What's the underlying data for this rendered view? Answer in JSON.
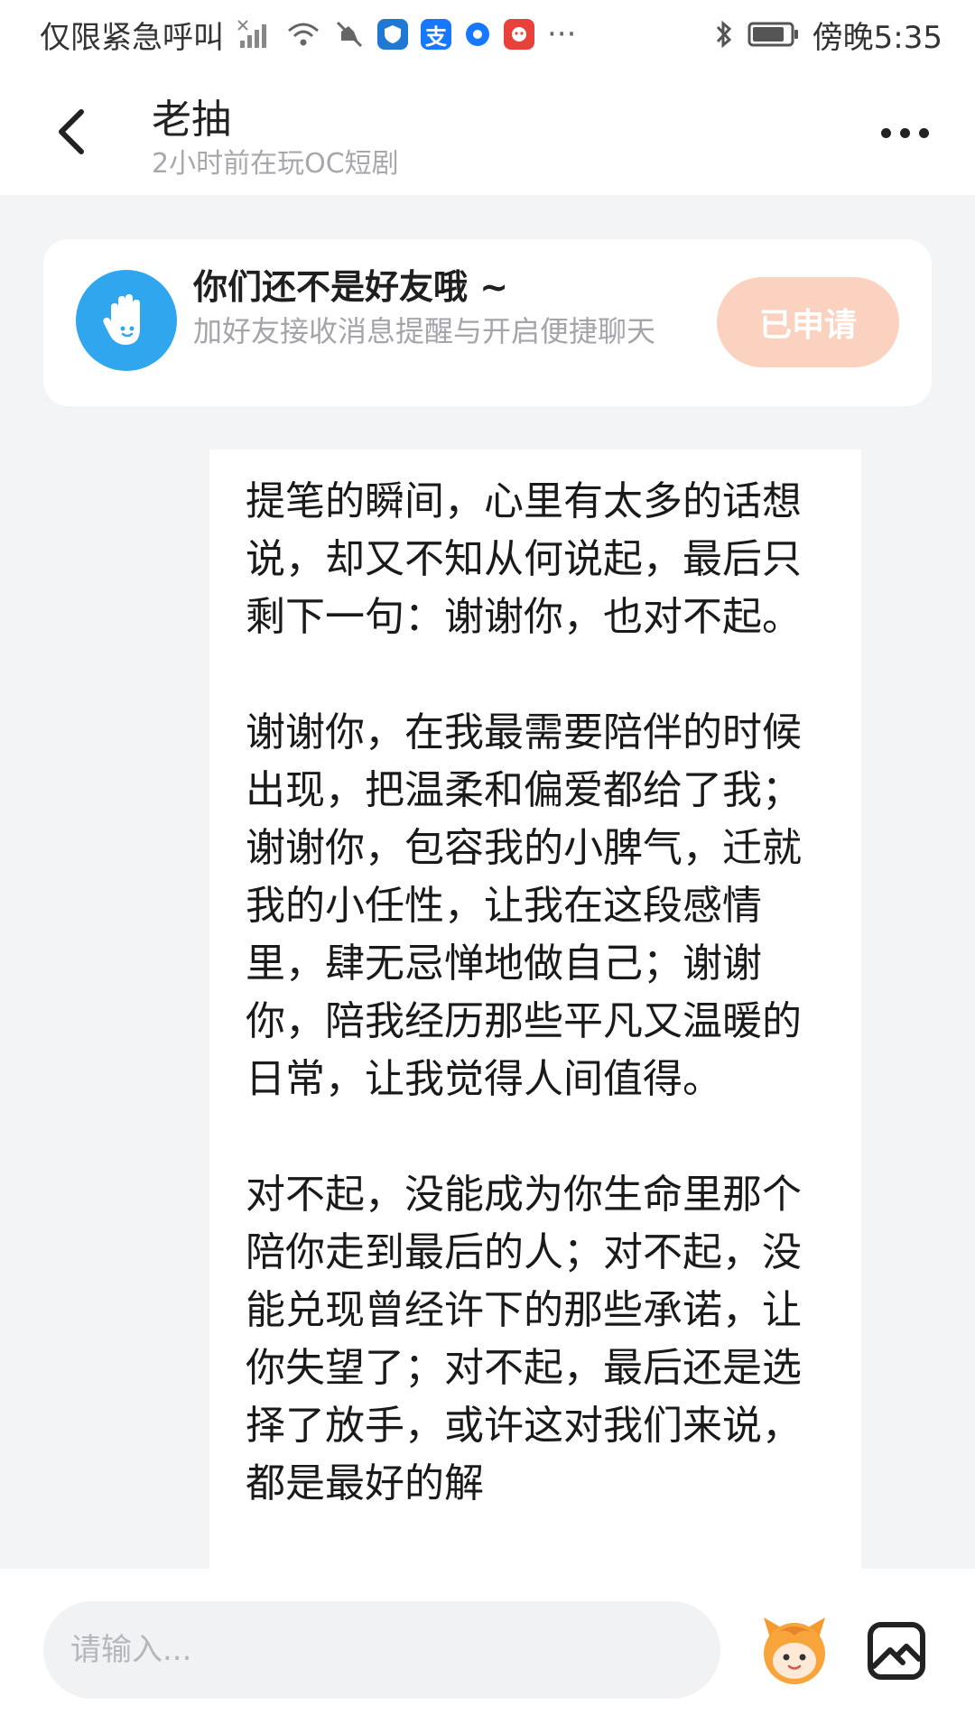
{
  "status_bar": {
    "carrier": "仅限紧急呼叫",
    "app_badge_alipay": "支",
    "more": "···",
    "time_label": "傍晚5:35"
  },
  "header": {
    "title": "老抽",
    "subtitle": "2小时前在玩OC短剧"
  },
  "friend_card": {
    "title": "你们还不是好友哦 ~",
    "description": "加好友接收消息提醒与开启便捷聊天",
    "button_label": "已申请",
    "button_color": "#fbd2bf",
    "avatar_color": "#2fa6ee"
  },
  "message": {
    "text": "提笔的瞬间，心里有太多的话想说，却又不知从何说起，最后只剩下一句：谢谢你，也对不起。\n\n谢谢你，在我最需要陪伴的时候出现，把温柔和偏爱都给了我；谢谢你，包容我的小脾气，迁就我的小任性，让我在这段感情里，肆无忌惮地做自己；谢谢你，陪我经历那些平凡又温暖的日常，让我觉得人间值得。\n\n对不起，没能成为你生命里那个陪你走到最后的人；对不起，没能兑现曾经许下的那些承诺，让你失望了；对不起，最后还是选择了放手，或许这对我们来说，都是最好的解"
  },
  "input_bar": {
    "placeholder": "请输入..."
  }
}
